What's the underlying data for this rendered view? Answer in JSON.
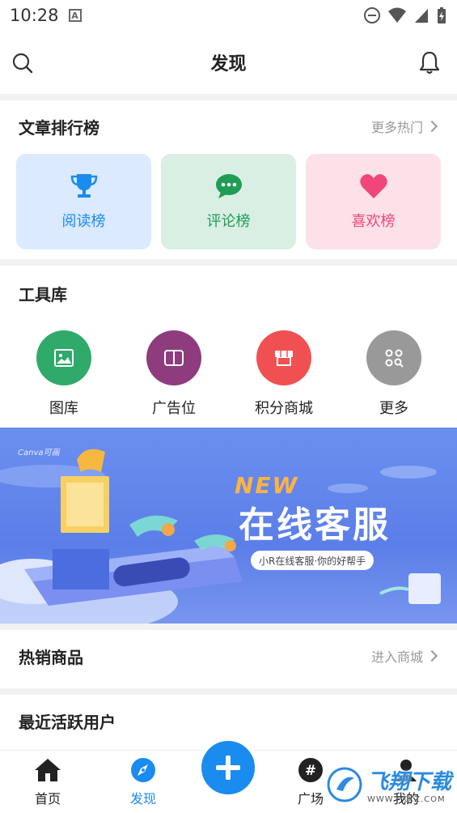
{
  "status": {
    "time": "10:28",
    "badge": "A"
  },
  "header": {
    "title": "发现"
  },
  "ranking": {
    "title": "文章排行榜",
    "more": "更多热门",
    "tiles": [
      {
        "label": "阅读榜",
        "icon": "trophy-icon",
        "color": "#1a8cf0",
        "bg": "#dbeaff"
      },
      {
        "label": "评论榜",
        "icon": "chat-bubble-icon",
        "color": "#1f9d55",
        "bg": "#d9efe4"
      },
      {
        "label": "喜欢榜",
        "icon": "heart-icon",
        "color": "#f0467a",
        "bg": "#fde1e8"
      }
    ]
  },
  "tools": {
    "title": "工具库",
    "items": [
      {
        "label": "图库",
        "icon": "image-icon",
        "color": "#2faa6a"
      },
      {
        "label": "广告位",
        "icon": "book-icon",
        "color": "#8e3c7e"
      },
      {
        "label": "积分商城",
        "icon": "shop-icon",
        "color": "#f05052"
      },
      {
        "label": "更多",
        "icon": "grid-search-icon",
        "color": "#999999"
      }
    ]
  },
  "banner": {
    "brand": "Canva可画",
    "new": "NEW",
    "title": "在线客服",
    "subtitle": "小R在线客服·你的好帮手"
  },
  "hot": {
    "title": "热销商品",
    "more": "进入商城"
  },
  "active": {
    "title": "最近活跃用户"
  },
  "tabbar": {
    "tabs": [
      {
        "label": "首页",
        "icon": "home-icon"
      },
      {
        "label": "发现",
        "icon": "compass-icon",
        "active": true
      },
      {
        "label": "广场",
        "icon": "hashtag-icon"
      },
      {
        "label": "我的",
        "icon": "user-icon"
      }
    ],
    "accent": "#1a8cf0"
  },
  "watermark": {
    "text": "飞翔下载",
    "url_text": "WWW.FXXZ.COM"
  }
}
